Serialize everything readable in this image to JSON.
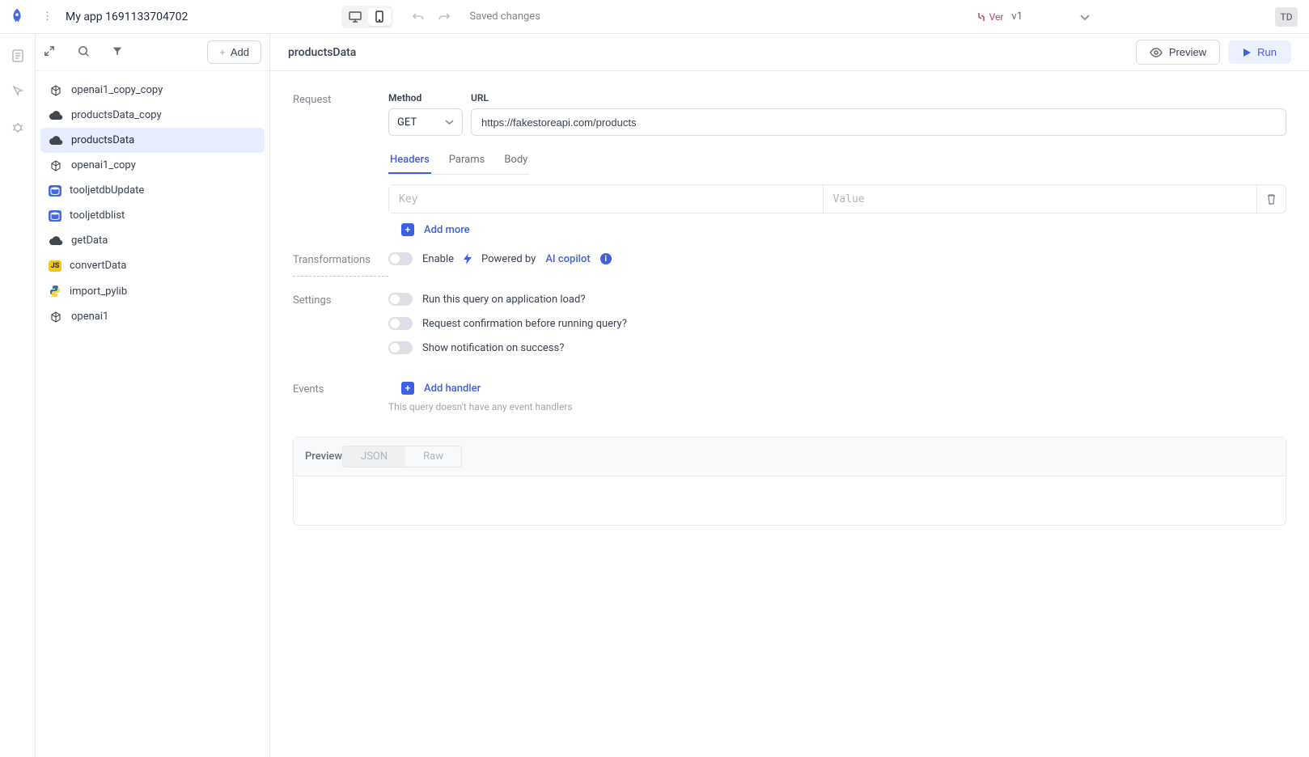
{
  "topbar": {
    "app_name": "My app 1691133704702",
    "save_status": "Saved changes",
    "version_prefix": "Ver",
    "version_value": "v1",
    "avatar": "TD"
  },
  "sidebar": {
    "add_label": "Add",
    "items": [
      {
        "label": "openai1_copy_copy",
        "icon": "openai"
      },
      {
        "label": "productsData_copy",
        "icon": "cloud"
      },
      {
        "label": "productsData",
        "icon": "cloud",
        "selected": true
      },
      {
        "label": "openai1_copy",
        "icon": "openai"
      },
      {
        "label": "tooljetdbUpdate",
        "icon": "db"
      },
      {
        "label": "tooljetdblist",
        "icon": "db"
      },
      {
        "label": "getData",
        "icon": "cloud"
      },
      {
        "label": "convertData",
        "icon": "js"
      },
      {
        "label": "import_pylib",
        "icon": "py"
      },
      {
        "label": "openai1",
        "icon": "openai"
      }
    ]
  },
  "main": {
    "header": {
      "title": "productsData",
      "preview_label": "Preview",
      "run_label": "Run"
    },
    "request": {
      "section": "Request",
      "method_label": "Method",
      "method_value": "GET",
      "url_label": "URL",
      "url_value": "https://fakestoreapi.com/products",
      "tabs": {
        "headers": "Headers",
        "params": "Params",
        "body": "Body"
      },
      "kv_key_placeholder": "Key",
      "kv_value_placeholder": "Value",
      "add_more": "Add more"
    },
    "transformations": {
      "section": "Transformations",
      "enable": "Enable",
      "powered": "Powered by",
      "ai_copilot": "AI copilot"
    },
    "settings": {
      "section": "Settings",
      "opt1": "Run this query on application load?",
      "opt2": "Request confirmation before running query?",
      "opt3": "Show notification on success?"
    },
    "events": {
      "section": "Events",
      "add_handler": "Add handler",
      "empty": "This query doesn't have any event handlers"
    },
    "preview_panel": {
      "title": "Preview",
      "json": "JSON",
      "raw": "Raw"
    }
  }
}
